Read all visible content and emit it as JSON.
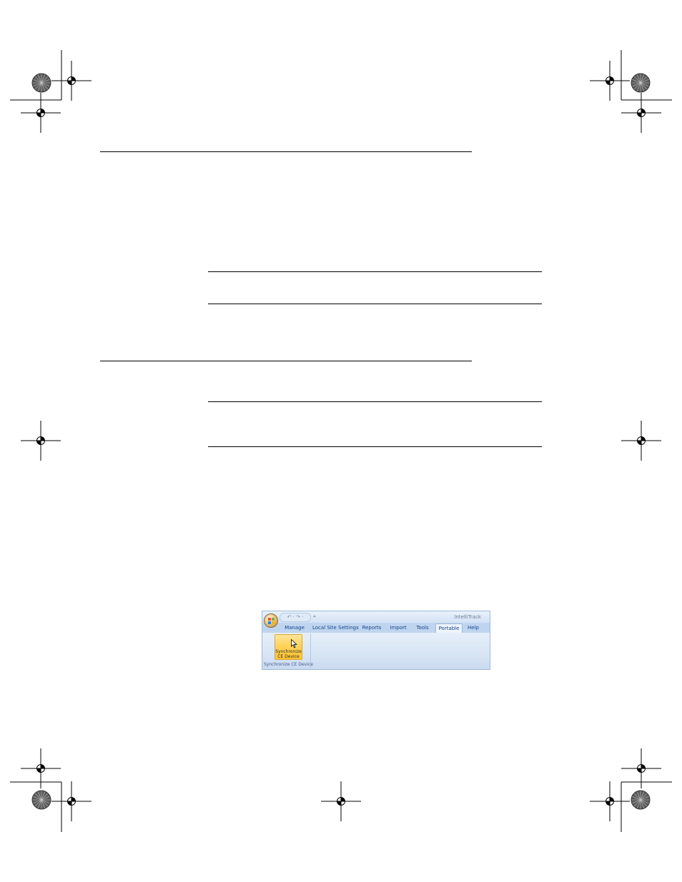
{
  "ribbon": {
    "app_title": "IntelliTrack",
    "quick_access_glyphs": "↶ · ↷ ·",
    "quick_access_more": "⩡",
    "tabs": [
      {
        "label": "Manage"
      },
      {
        "label": "Local Site Settings"
      },
      {
        "label": "Reports"
      },
      {
        "label": "Import"
      },
      {
        "label": "Tools"
      },
      {
        "label": "Portable",
        "active": true
      },
      {
        "label": "Help"
      }
    ],
    "button": {
      "line1": "Synchronize",
      "line2": "CE Device"
    },
    "group_label": "Synchronize CE Device"
  }
}
